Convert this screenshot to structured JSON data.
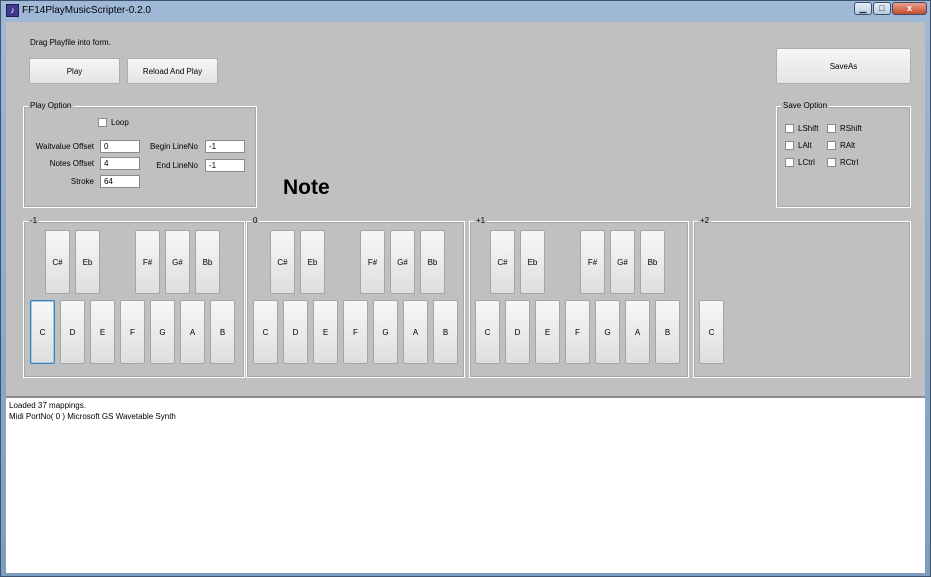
{
  "window": {
    "title": "FF14PlayMusicScripter-0.2.0",
    "icon_glyph": "♪",
    "minimize_glyph": "▁",
    "maximize_glyph": "□",
    "close_glyph": "x"
  },
  "hint": "Drag Playfile into form.",
  "buttons": {
    "play": "Play",
    "reload_and_play": "Reload And Play",
    "save_as": "SaveAs"
  },
  "play_option": {
    "title": "Play Option",
    "loop_label": "Loop",
    "loop_checked": false,
    "waitvalue_offset_label": "Waitvalue Offset",
    "waitvalue_offset_value": "0",
    "notes_offset_label": "Notes Offset",
    "notes_offset_value": "4",
    "stroke_label": "Stroke",
    "stroke_value": "64",
    "begin_lineno_label": "Begin LineNo",
    "begin_lineno_value": "-1",
    "end_lineno_label": "End LineNo",
    "end_lineno_value": "-1"
  },
  "save_option": {
    "title": "Save Option",
    "lshift": "LShift",
    "rshift": "RShift",
    "lalt": "LAlt",
    "ralt": "RAlt",
    "lctrl": "LCtrl",
    "rctrl": "RCtrl"
  },
  "note_title": "Note",
  "octaves": [
    {
      "label": "-1",
      "black": [
        "C#",
        "Eb",
        "F#",
        "G#",
        "Bb"
      ],
      "white": [
        "C",
        "D",
        "E",
        "F",
        "G",
        "A",
        "B"
      ]
    },
    {
      "label": "0",
      "black": [
        "C#",
        "Eb",
        "F#",
        "G#",
        "Bb"
      ],
      "white": [
        "C",
        "D",
        "E",
        "F",
        "G",
        "A",
        "B"
      ]
    },
    {
      "label": "+1",
      "black": [
        "C#",
        "Eb",
        "F#",
        "G#",
        "Bb"
      ],
      "white": [
        "C",
        "D",
        "E",
        "F",
        "G",
        "A",
        "B"
      ]
    },
    {
      "label": "+2",
      "black": [],
      "white": [
        "C"
      ]
    }
  ],
  "log": [
    "Loaded 37 mappings.",
    "Midi PortNo( 0 ) Microsoft GS Wavetable Synth"
  ]
}
